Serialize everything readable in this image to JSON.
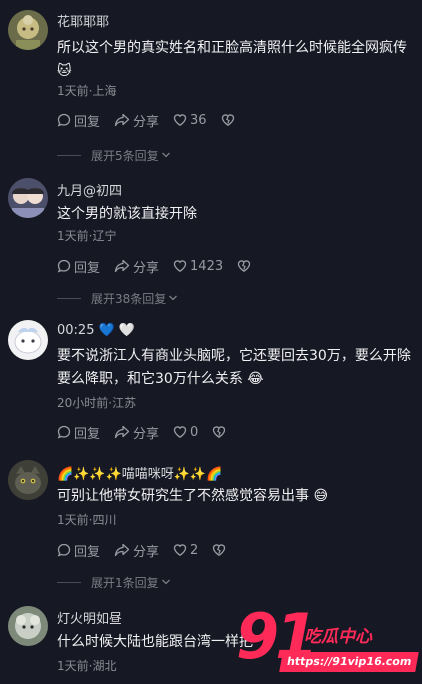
{
  "comments": [
    {
      "username": "花耶耶耶",
      "text": "所以这个男的真实姓名和正脸高清照什么时候能全网疯传 🐱",
      "meta": "1天前·上海",
      "reply_label": "回复",
      "share_label": "分享",
      "likes": "36",
      "expand_label": "展开5条回复"
    },
    {
      "username": "九月@初四",
      "text": "这个男的就该直接开除",
      "meta": "1天前·辽宁",
      "reply_label": "回复",
      "share_label": "分享",
      "likes": "1423",
      "expand_label": "展开38条回复"
    },
    {
      "username": "00:25 💙 🤍",
      "text": "要不说浙江人有商业头脑呢，它还要回去30万，要么开除要么降职，和它30万什么关系 😂",
      "meta": "20小时前·江苏",
      "reply_label": "回复",
      "share_label": "分享",
      "likes": "0",
      "expand_label": ""
    },
    {
      "username": "🌈✨✨✨喵喵咪呀✨✨🌈",
      "text": "可别让他带女研究生了不然感觉容易出事 😅",
      "meta": "1天前·四川",
      "reply_label": "回复",
      "share_label": "分享",
      "likes": "2",
      "expand_label": "展开1条回复"
    },
    {
      "username": "灯火明如昼",
      "text": "什么时候大陆也能跟台湾一样把",
      "meta": "1天前·湖北",
      "reply_label": "",
      "share_label": "",
      "likes": "",
      "expand_label": ""
    }
  ],
  "watermark": {
    "number": "91",
    "title": "吃瓜中心",
    "url": "https://91vip16.com"
  },
  "icons": {
    "reply": "comment-bubble-icon",
    "share": "share-arrow-icon",
    "like": "heart-icon",
    "dislike": "broken-heart-icon",
    "expand": "chevron-down-icon"
  },
  "colors": {
    "background": "#161823",
    "watermark": "#ff2a58"
  }
}
